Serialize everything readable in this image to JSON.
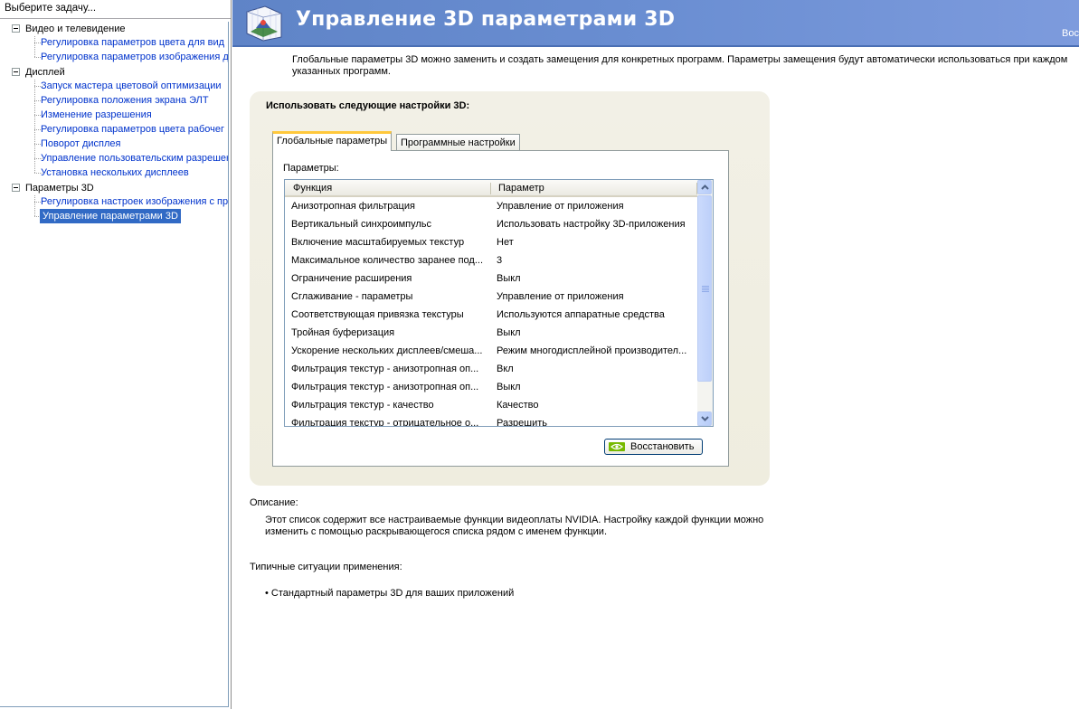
{
  "left_pane": {
    "header": "Выберите задачу...",
    "categories": [
      {
        "label": "Видео и телевидение",
        "items": [
          "Регулировка параметров цвета для вид",
          "Регулировка параметров изображения д"
        ]
      },
      {
        "label": "Дисплей",
        "items": [
          "Запуск мастера цветовой оптимизации",
          "Регулировка положения экрана ЭЛТ",
          "Изменение разрешения",
          "Регулировка параметров цвета рабочег",
          "Поворот дисплея",
          "Управление пользовательским разрешен",
          "Установка нескольких дисплеев"
        ]
      },
      {
        "label": "Параметры 3D",
        "items": [
          "Регулировка настроек изображения с пр",
          "Управление параметрами 3D"
        ]
      }
    ],
    "selected_item": "Управление параметрами 3D"
  },
  "banner": {
    "title": "Управление 3D параметрами 3D",
    "right_text": "Вос",
    "icon": "nvidia-3d-settings-icon"
  },
  "intro": "Глобальные параметры 3D можно заменить и создать замещения для конкретных программ. Параметры замещения будут автоматически использоваться при каждом указанных программ.",
  "settings": {
    "title": "Использовать следующие настройки 3D:",
    "tabs": [
      "Глобальные параметры",
      "Программные настройки"
    ],
    "active_tab": "Глобальные параметры",
    "params_label": "Параметры:",
    "columns": [
      "Функция",
      "Параметр"
    ],
    "rows": [
      [
        "Анизотропная фильтрация",
        "Управление от приложения"
      ],
      [
        "Вертикальный синхроимпульс",
        "Использовать настройку 3D-приложения"
      ],
      [
        "Включение масштабируемых текстур",
        "Нет"
      ],
      [
        "Максимальное количество заранее под...",
        "3"
      ],
      [
        "Ограничение расширения",
        "Выкл"
      ],
      [
        "Сглаживание - параметры",
        "Управление от приложения"
      ],
      [
        "Соответствующая привязка текстуры",
        "Используются аппаратные средства"
      ],
      [
        "Тройная буферизация",
        "Выкл"
      ],
      [
        "Ускорение нескольких дисплеев/смеша...",
        "Режим многодисплейной производител..."
      ],
      [
        "Фильтрация текстур - анизотропная оп...",
        "Вкл"
      ],
      [
        "Фильтрация текстур - анизотропная оп...",
        "Выкл"
      ],
      [
        "Фильтрация текстур - качество",
        "Качество"
      ],
      [
        "Фильтрация текстур - отрицательное о...",
        "Разрешить"
      ]
    ],
    "restore_button": "Восстановить",
    "restore_icon": "nvidia-logo-icon"
  },
  "description": {
    "title": "Описание:",
    "text": "Этот список содержит все настраиваемые функции видеоплаты NVIDIA. Настройку каждой функции можно изменить с помощью раскрывающегося списка рядом с именем функции."
  },
  "usage": {
    "title": "Типичные ситуации применения:",
    "items": [
      "• Стандартный параметры 3D для ваших приложений"
    ]
  },
  "colors": {
    "banner": "#6a8ed2",
    "selection": "#316ac5",
    "link": "#0033cc",
    "tab_highlight": "#ffc83c"
  }
}
